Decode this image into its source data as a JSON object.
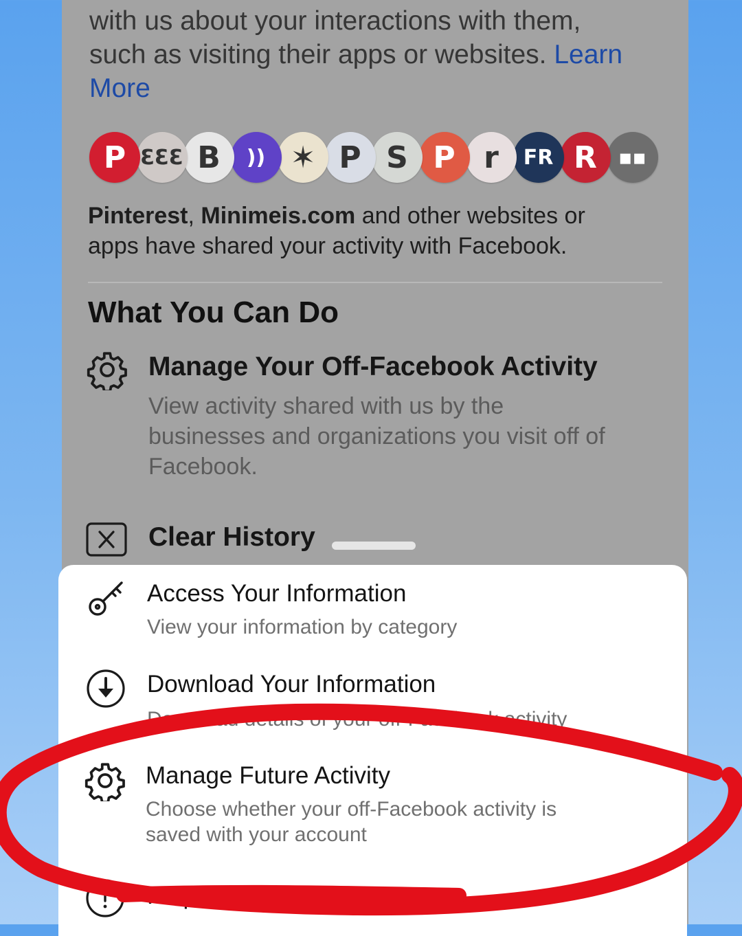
{
  "intro": {
    "line1": "with us about your interactions with them,",
    "line2": "such as visiting their apps or websites.",
    "learn_more_1": "Learn",
    "learn_more_2": "More"
  },
  "logos": [
    {
      "name": "pinterest",
      "letter": "P",
      "color": "#d21e30"
    },
    {
      "name": "minimeis",
      "letter": "ƐƐƐ",
      "color": "#cfc9c7"
    },
    {
      "name": "b-circle",
      "letter": "B",
      "color": "#e7e7e7"
    },
    {
      "name": "podcast",
      "letter": "))",
      "color": "#5f42c7"
    },
    {
      "name": "spark",
      "letter": "✶",
      "color": "#ebe3cf"
    },
    {
      "name": "paypal",
      "letter": "P",
      "color": "#d9dde6"
    },
    {
      "name": "shopify",
      "letter": "S",
      "color": "#d5d8d4"
    },
    {
      "name": "patreon",
      "letter": "P",
      "color": "#e05a44"
    },
    {
      "name": "realtor",
      "letter": "r",
      "color": "#e8dfe0"
    },
    {
      "name": "fr",
      "letter": "FR",
      "color": "#1f3559"
    },
    {
      "name": "r-red",
      "letter": "R",
      "color": "#c42333"
    },
    {
      "name": "microsoft",
      "letter": "▪▪",
      "color": "#6e6e6e"
    }
  ],
  "shared_text": {
    "bold1": "Pinterest",
    "sep": ", ",
    "bold2": "Minimeis.com",
    "rest1": " and other websites or",
    "rest2": "apps have shared your activity with Facebook."
  },
  "section_title": "What You Can Do",
  "manage_offfb": {
    "title": "Manage Your Off-Facebook Activity",
    "desc1": "View activity shared with us by the",
    "desc2": "businesses and organizations you visit off of",
    "desc3": "Facebook."
  },
  "clear_history": {
    "title": "Clear History"
  },
  "sheet": {
    "access": {
      "title": "Access Your Information",
      "desc": "View your information by category"
    },
    "download": {
      "title": "Download Your Information",
      "desc": "Download details of your off-Facebook activity"
    },
    "future": {
      "title": "Manage Future Activity",
      "desc1": "Choose whether your off-Facebook activity is",
      "desc2": "saved with your account"
    },
    "help": {
      "title": "Help"
    }
  },
  "colors": {
    "link": "#1d4aa6",
    "annotation": "#e3101a",
    "overlay": "#a3a3a3"
  },
  "icons": [
    "gear-icon",
    "close-box-icon",
    "key-icon",
    "download-circle-icon",
    "help-circle-icon"
  ]
}
